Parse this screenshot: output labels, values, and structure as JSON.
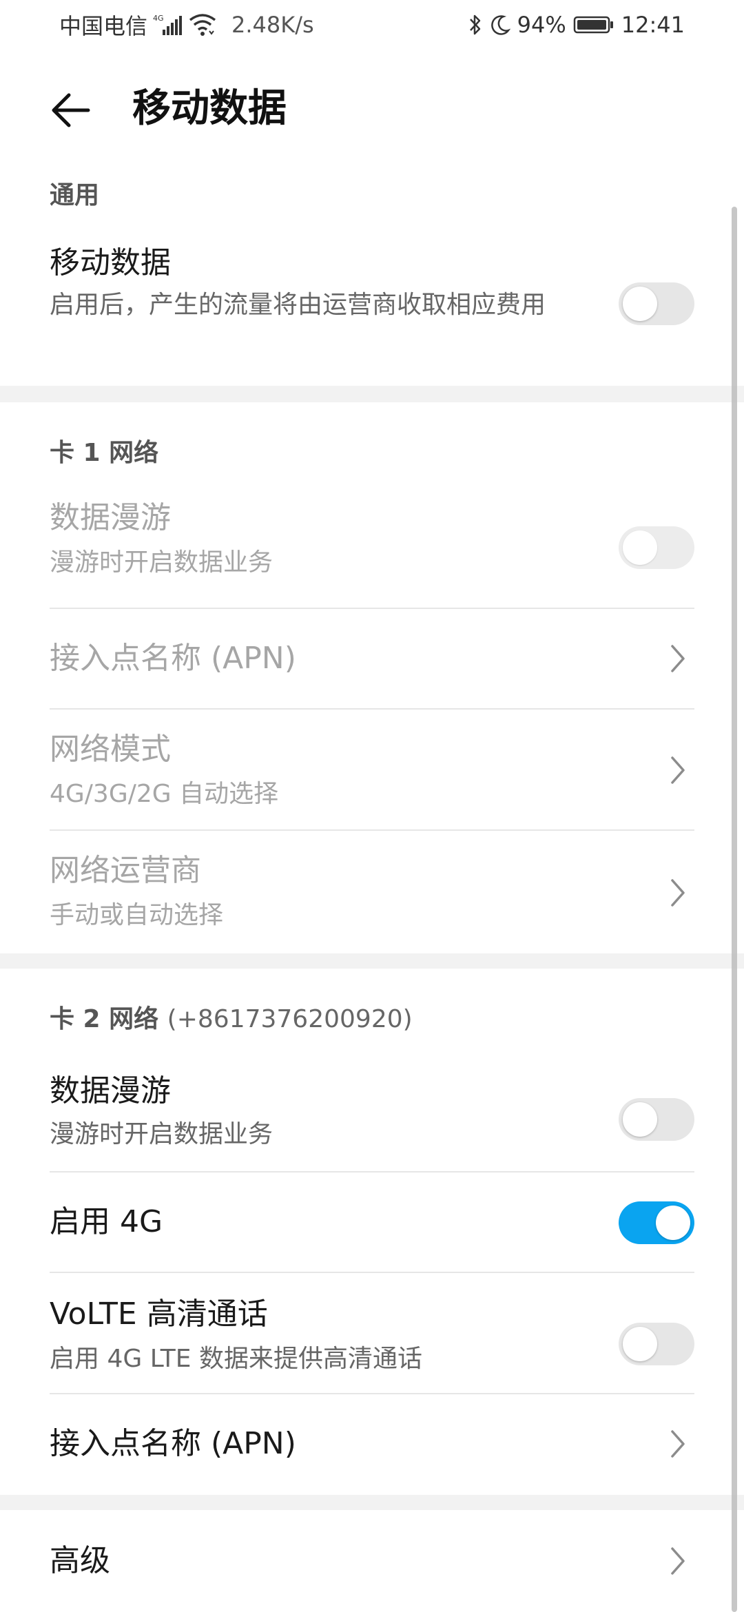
{
  "status_bar": {
    "carrier": "中国电信",
    "network": "4G",
    "speed": "2.48K/s",
    "battery": "94%",
    "time": "12:41"
  },
  "header": {
    "title": "移动数据"
  },
  "general": {
    "section_title": "通用",
    "mobile_data": {
      "title": "移动数据",
      "subtitle": "启用后，产生的流量将由运营商收取相应费用",
      "enabled": false
    }
  },
  "sim1": {
    "section_title": "卡 1 网络",
    "data_roaming": {
      "title": "数据漫游",
      "subtitle": "漫游时开启数据业务",
      "enabled": false
    },
    "apn": {
      "title": "接入点名称 (APN)"
    },
    "network_mode": {
      "title": "网络模式",
      "subtitle": "4G/3G/2G 自动选择"
    },
    "operator": {
      "title": "网络运营商",
      "subtitle": "手动或自动选择"
    }
  },
  "sim2": {
    "section_title": "卡 2 网络",
    "phone": "(+8617376200920)",
    "data_roaming": {
      "title": "数据漫游",
      "subtitle": "漫游时开启数据业务",
      "enabled": false
    },
    "enable_4g": {
      "title": "启用 4G",
      "enabled": true
    },
    "volte": {
      "title": "VoLTE 高清通话",
      "subtitle": "启用 4G LTE 数据来提供高清通话",
      "enabled": false
    },
    "apn": {
      "title": "接入点名称 (APN)"
    }
  },
  "advanced": {
    "title": "高级"
  },
  "colors": {
    "accent": "#0aa4f0",
    "gap": "#f2f2f2",
    "divider": "#e6e6e6",
    "disabled_text": "#a6a6a6"
  }
}
